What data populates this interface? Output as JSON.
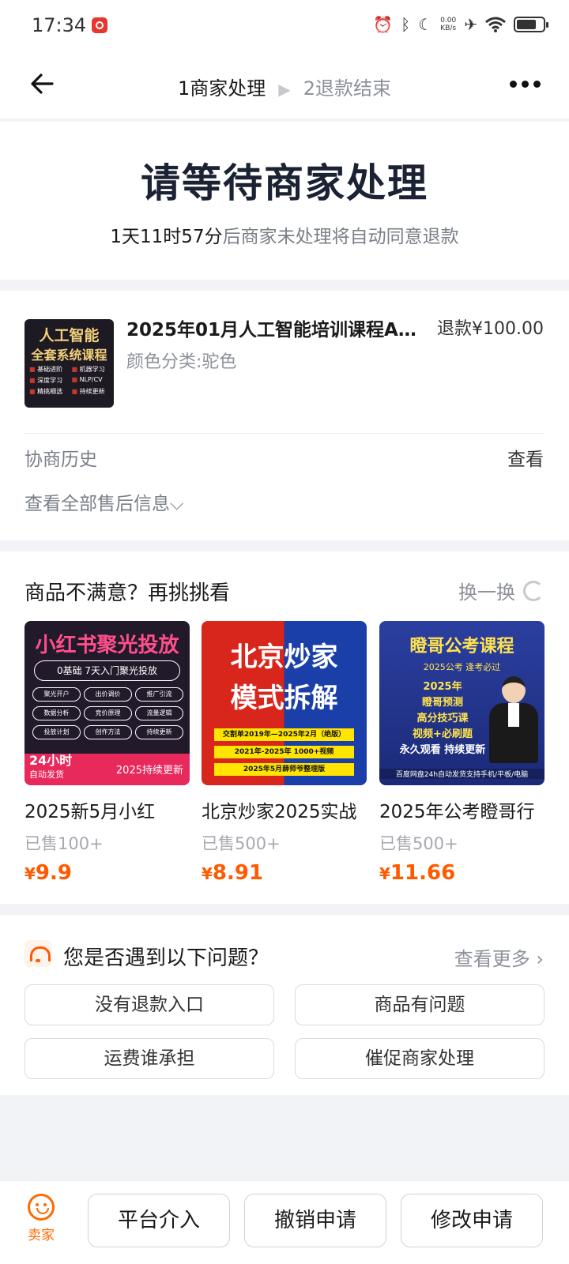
{
  "status_bar": {
    "time": "17:34",
    "speed_value": "0.00",
    "speed_unit": "KB/s",
    "icons": [
      "app-notification-icon",
      "alarm-icon",
      "bluetooth-icon",
      "moon-icon",
      "airplane-icon",
      "wifi-icon",
      "battery-icon"
    ]
  },
  "nav": {
    "step1": "1商家处理",
    "step2": "2退款结束",
    "step_separator": "▶"
  },
  "hero": {
    "title": "请等待商家处理",
    "countdown": "1天11时57分",
    "subtitle_rest": "后商家未处理将自动同意退款"
  },
  "product": {
    "thumb_title": "人工智能",
    "thumb_subtitle": "全套系统课程",
    "thumb_tags": [
      "基础进阶",
      "机器学习",
      "深度学习",
      "NLP/CV",
      "精挑细选",
      "持续更新"
    ],
    "title": "2025年01月人工智能培训课程A…",
    "variant": "颜色分类:驼色",
    "refund": "退款¥100.00",
    "history_label": "协商历史",
    "history_link": "查看",
    "all_info": "查看全部售后信息⌵"
  },
  "recommendations": {
    "title": "商品不满意？再挑挑看",
    "refresh": "换一换",
    "items": [
      {
        "name": "2025新5月小红",
        "sold": "已售100+",
        "currency": "¥",
        "price": "9.9",
        "image": {
          "headline": "小红书聚光投放",
          "pill": "0基础 7天入门聚光投放",
          "tags": [
            "聚光开户",
            "出价调价",
            "推广引流",
            "数据分析",
            "竞价原理",
            "流量逻辑",
            "投放计划",
            "创作方法",
            "持续更新"
          ],
          "badge_big": "24小时",
          "badge_small": "自动发货",
          "ribbon": "2025持续更新"
        }
      },
      {
        "name": "北京炒家2025实战",
        "sold": "已售500+",
        "currency": "¥",
        "price": "8.91",
        "image": {
          "line1": "北京炒家",
          "line2": "模式拆解",
          "bar1": "交割单2019年—2025年2月（绝版）",
          "bar2": "2021年-2025年   1000+视频",
          "bar3": "2025年5月薛师爷整理版"
        }
      },
      {
        "name": "2025年公考瞪哥行",
        "sold": "已售500+",
        "currency": "¥",
        "price": "11.66",
        "image": {
          "headline": "瞪哥公考课程",
          "sub": "2025公考 逢考必过",
          "lines": [
            "2025年",
            "瞪哥预测",
            "高分技巧课",
            "视频+必刷题"
          ],
          "tagline": "永久观看 持续更新",
          "footer": "百度网盘24h自动发货支持手机/平板/电脑"
        }
      }
    ]
  },
  "problems": {
    "title": "您是否遇到以下问题？",
    "more": "查看更多 ›",
    "buttons": [
      "没有退款入口",
      "商品有问题",
      "运费谁承担",
      "催促商家处理"
    ]
  },
  "bottom": {
    "seller_label": "卖家",
    "actions": [
      "平台介入",
      "撤销申请",
      "修改申请"
    ]
  }
}
